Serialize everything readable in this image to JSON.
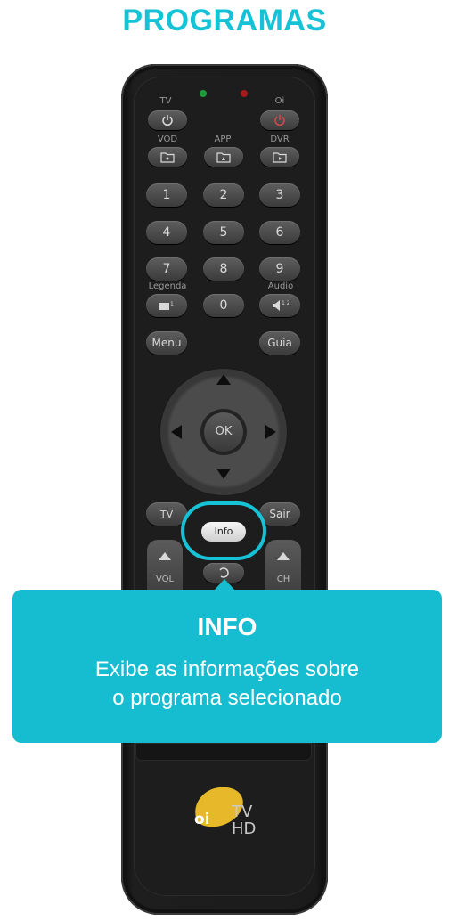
{
  "page": {
    "title": "PROGRAMAS"
  },
  "colors": {
    "accent": "#16c2d6",
    "tooltip": "#16bdd0",
    "remote_body": "#1d1d1d",
    "led_green": "#1e9c3a",
    "led_red": "#a31a1a",
    "logo": "#e6b82a"
  },
  "remote": {
    "labels": {
      "tv": "TV",
      "oi": "Oi",
      "vod": "VOD",
      "app": "APP",
      "dvr": "DVR",
      "legenda": "Legenda",
      "audio": "Áudio",
      "vol": "VOL",
      "ch": "CH"
    },
    "numbers": [
      "1",
      "2",
      "3",
      "4",
      "5",
      "6",
      "7",
      "8",
      "9",
      "0"
    ],
    "menu": "Menu",
    "guide": "Guia",
    "ok": "OK",
    "exit": "Sair",
    "info": "Info",
    "logo": {
      "brand": "oi",
      "tv": "TV",
      "hd": "HD"
    }
  },
  "tooltip": {
    "title": "INFO",
    "line1": "Exibe as informações sobre",
    "line2": "o programa selecionado"
  }
}
